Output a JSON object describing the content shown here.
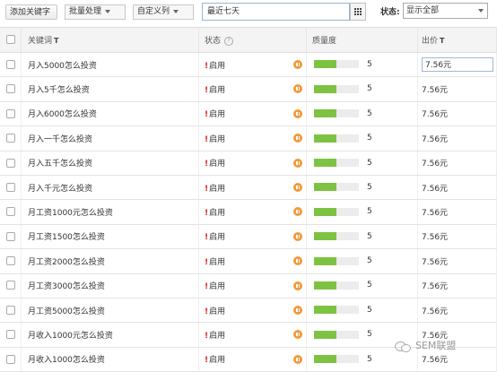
{
  "toolbar": {
    "add_keyword_label": "添加关键字",
    "batch_label": "批量处理",
    "custom_columns_label": "自定义列",
    "date_range_value": "最近七天",
    "status_label": "状态:",
    "status_value": "显示全部"
  },
  "table": {
    "columns": {
      "keyword": "关键词",
      "keyword_filter_icon": "T",
      "status": "状态",
      "status_help_icon": "?",
      "quality": "质量度",
      "bid": "出价",
      "bid_filter_icon": "T"
    },
    "rows": [
      {
        "keyword": "月入5000怎么投资",
        "status": "启用",
        "quality_text": "5",
        "quality_level": 0.5,
        "bid": "7.56元"
      },
      {
        "keyword": "月入5千怎么投资",
        "status": "启用",
        "quality_text": "5",
        "quality_level": 0.5,
        "bid": "7.56元"
      },
      {
        "keyword": "月入6000怎么投资",
        "status": "启用",
        "quality_text": "5",
        "quality_level": 0.5,
        "bid": "7.56元"
      },
      {
        "keyword": "月入一千怎么投资",
        "status": "启用",
        "quality_text": "5",
        "quality_level": 0.5,
        "bid": "7.56元"
      },
      {
        "keyword": "月入五千怎么投资",
        "status": "启用",
        "quality_text": "5",
        "quality_level": 0.5,
        "bid": "7.56元"
      },
      {
        "keyword": "月入千元怎么投资",
        "status": "启用",
        "quality_text": "5",
        "quality_level": 0.5,
        "bid": "7.56元"
      },
      {
        "keyword": "月工资1000元怎么投资",
        "status": "启用",
        "quality_text": "5",
        "quality_level": 0.5,
        "bid": "7.56元"
      },
      {
        "keyword": "月工资1500怎么投资",
        "status": "启用",
        "quality_text": "5",
        "quality_level": 0.5,
        "bid": "7.56元"
      },
      {
        "keyword": "月工资2000怎么投资",
        "status": "启用",
        "quality_text": "5",
        "quality_level": 0.5,
        "bid": "7.56元"
      },
      {
        "keyword": "月工资3000怎么投资",
        "status": "启用",
        "quality_text": "5",
        "quality_level": 0.5,
        "bid": "7.56元"
      },
      {
        "keyword": "月工资5000怎么投资",
        "status": "启用",
        "quality_text": "5",
        "quality_level": 0.5,
        "bid": "7.56元"
      },
      {
        "keyword": "月收入1000元怎么投资",
        "status": "启用",
        "quality_text": "5",
        "quality_level": 0.5,
        "bid": "7.56元"
      },
      {
        "keyword": "月收入1000怎么投资",
        "status": "启用",
        "quality_text": "5",
        "quality_level": 0.5,
        "bid": "7.56元"
      }
    ]
  },
  "colors": {
    "quality_bar": "#7dc242",
    "status_warning": "#e02020",
    "pause_icon": "#f29a3a"
  },
  "icons": {
    "warning": "exclamation-icon",
    "pause": "pause-circle-icon",
    "calendar": "calendar-grid-icon"
  },
  "watermark": {
    "text": "SEM联盟"
  }
}
